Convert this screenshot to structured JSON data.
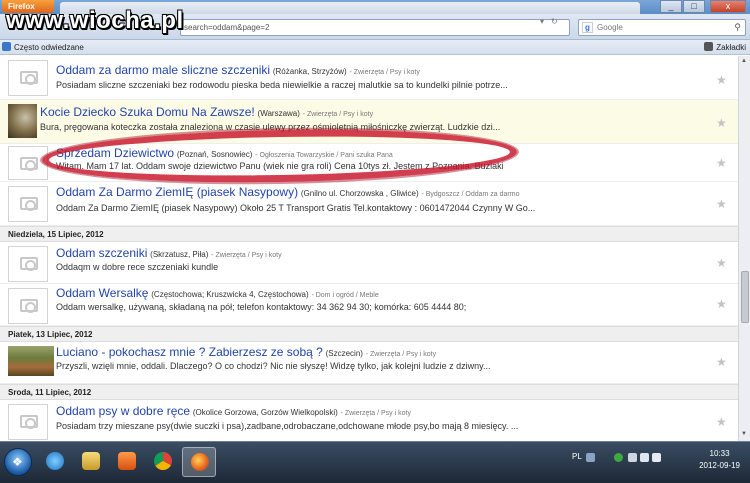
{
  "browser": {
    "menu_label": "Firefox",
    "url": "search=oddam&page=2",
    "search_placeholder": "Google",
    "bookmark_left": "Często odwiedzane",
    "bookmark_right": "Zakładki",
    "watermark": "www.wiocha.pl",
    "win_controls": [
      "_",
      "□",
      "x"
    ]
  },
  "listings": [
    {
      "title": "Oddam za darmo male sliczne szczeniki",
      "location": "(Różanka, Strzyżów)",
      "category": "- Zwierzęta / Psy i koty",
      "desc": "Posiadam sliczne szczeniaki bez rodowodu pieska beda niewielkie a raczej malutkie sa to kundelki pilnie potrze..."
    },
    {
      "title": "Kocie Dziecko Szuka Domu Na Zawsze!",
      "location": "(Warszawa)",
      "category": "- Zwierzęta / Psy i koty",
      "desc": "Bura, pręgowana koteczka została znaleziona w czasie ulewy przez ośmioletnią miłośniczkę zwierząt. Ludzkie dzi..."
    },
    {
      "title": "Sprzedam Dziewictwo",
      "location": "(Poznań, Sosnowiec)",
      "category": "- Ogłoszenia Towarzyskie / Pani szuka Pana",
      "desc": "Witam. Mam 17 lat. Oddam swoje dziewictwo Panu (wiek nie gra roli) Cena 10tys zł. Jestem z Poznania. Buziaki"
    },
    {
      "title": "Oddam Za Darmo ZiemIĘ (piasek Nasypowy)",
      "location": "(Gnilno ul. Chorzowska , Gliwice)",
      "category": "- Bydgoszcz / Oddam za darmo",
      "desc": "Oddam Za Darmo ZiemIĘ (piasek Nasypowy) Około 25 T Transport Gratis Tel.kontaktowy : 0601472044 Czynny W Go..."
    },
    {
      "title": "Oddam szczeniki",
      "location": "(Skrzatusz, Piła)",
      "category": "- Zwierzęta / Psy i koty",
      "desc": "Oddaqm w dobre rece szczeniaki kundle"
    },
    {
      "title": "Oddam Wersalkę",
      "location": "(Częstochowa; Kruszwicka 4, Częstochowa)",
      "category": "- Dom i ogród / Meble",
      "desc": "Oddam wersalkę, używaną, składaną na pół; telefon kontaktowy: 34 362 94 30; komórka: 605 4444 80;"
    },
    {
      "title": "Luciano - pokochasz mnie ? Zabierzesz ze sobą ?",
      "location": "(Szczecin)",
      "category": "- Zwierzęta / Psy i koty",
      "desc": "Przyszli, wzięli mnie, oddali. Dlaczego? O co chodzi? Nic nie słyszę! Widzę tylko, jak kolejni ludzie z dziwny..."
    },
    {
      "title": "Oddam psy w dobre ręce",
      "location": "(Okolice Gorzowa, Gorzów Wielkopolski)",
      "category": "- Zwierzęta / Psy i koty",
      "desc": "Posiadam trzy mieszane psy(dwie suczki i psa),zadbane,odrobaczane,odchowane młode psy,bo mają 8 miesięcy. ..."
    }
  ],
  "day_headers": [
    "Niedziela, 15 Lipiec, 2012",
    "Piatek, 13 Lipiec, 2012",
    "Sroda, 11 Lipiec, 2012"
  ],
  "taskbar": {
    "lang": "PL",
    "time": "10:33",
    "date": "2012-09-19"
  }
}
